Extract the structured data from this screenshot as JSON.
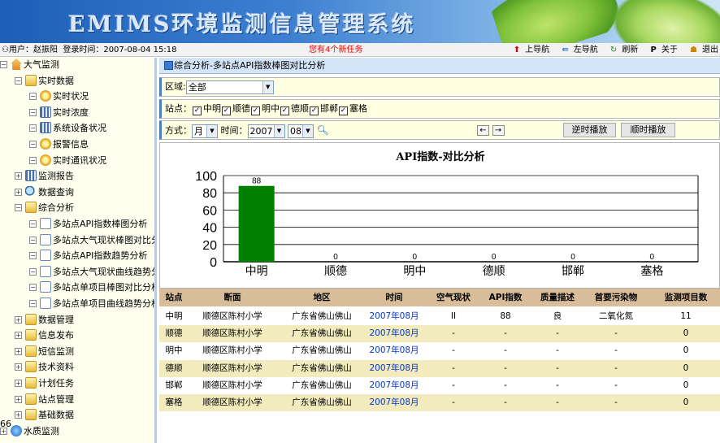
{
  "banner": {
    "title": "EMIMS环境监测信息管理系统"
  },
  "topbar": {
    "user_label": "用户：赵振阳",
    "login_label": "登录时间：2007-08-04 15:18",
    "notice": "您有4个新任务",
    "nav": {
      "up": "上导航",
      "left": "左导航",
      "refresh": "刷新",
      "about": "关于",
      "exit": "退出"
    }
  },
  "sidebar": {
    "items": [
      {
        "label": "大气监测",
        "icon": "home-icon",
        "level": 0,
        "expanded": true
      },
      {
        "label": "实时数据",
        "icon": "folder-icon",
        "level": 1,
        "expanded": true
      },
      {
        "label": "实时状况",
        "icon": "gear-icon",
        "level": 2
      },
      {
        "label": "实时浓度",
        "icon": "grid-icon",
        "level": 2
      },
      {
        "label": "系统设备状况",
        "icon": "grid-icon",
        "level": 2
      },
      {
        "label": "报警信息",
        "icon": "gear-icon",
        "level": 2
      },
      {
        "label": "实时通讯状况",
        "icon": "gear-icon",
        "level": 2
      },
      {
        "label": "监测报告",
        "icon": "grid-icon",
        "level": 1,
        "expanded": false
      },
      {
        "label": "数据查询",
        "icon": "search-icon",
        "level": 1,
        "expanded": false
      },
      {
        "label": "综合分析",
        "icon": "folder-icon",
        "level": 1,
        "expanded": true
      },
      {
        "label": "多站点API指数棒图分析",
        "icon": "doc-icon",
        "level": 2
      },
      {
        "label": "多站点大气现状棒图对比分",
        "icon": "doc-icon",
        "level": 2
      },
      {
        "label": "多站点API指数趋势分析",
        "icon": "doc-icon",
        "level": 2
      },
      {
        "label": "多站点大气现状曲线趋势分",
        "icon": "doc-icon",
        "level": 2
      },
      {
        "label": "多站点单项目棒图对比分析",
        "icon": "doc-icon",
        "level": 2
      },
      {
        "label": "多站点单项目曲线趋势分析",
        "icon": "doc-icon",
        "level": 2
      },
      {
        "label": "数据管理",
        "icon": "folder-icon",
        "level": 1,
        "expanded": false
      },
      {
        "label": "信息发布",
        "icon": "folder-icon",
        "level": 1,
        "expanded": false
      },
      {
        "label": "短信监测",
        "icon": "folder-icon",
        "level": 1,
        "expanded": false
      },
      {
        "label": "技术资料",
        "icon": "folder-icon",
        "level": 1,
        "expanded": false
      },
      {
        "label": "计划任务",
        "icon": "folder-icon",
        "level": 1,
        "expanded": false
      },
      {
        "label": "站点管理",
        "icon": "folder-icon",
        "level": 1,
        "expanded": false
      },
      {
        "label": "基础数据",
        "icon": "folder-icon",
        "level": 1,
        "expanded": false
      },
      {
        "label": "水质监测",
        "icon": "globe-icon",
        "level": 0,
        "expanded": false
      }
    ],
    "page_number": "66"
  },
  "crumb": "综合分析-多站点API指数棒图对比分析",
  "filters": {
    "region_label": "区域:",
    "region_value": "全部",
    "station_label": "站点：",
    "stations": [
      "中明",
      "顺德",
      "明中",
      "德顺",
      "邯郸",
      "塞格"
    ],
    "mode_label": "方式：",
    "mode_value": "月",
    "time_label": "时间：",
    "year_value": "2007",
    "month_value": "08",
    "prev_label": "←",
    "next_label": "→",
    "reverse_play": "逆时播放",
    "forward_play": "顺时播放"
  },
  "chart_data": {
    "type": "bar",
    "title": "API指数-对比分析",
    "categories": [
      "中明",
      "顺德",
      "明中",
      "德顺",
      "邯郸",
      "塞格"
    ],
    "values": [
      88,
      0,
      0,
      0,
      0,
      0
    ],
    "ylim": [
      0,
      100
    ],
    "yticks": [
      0,
      20,
      40,
      60,
      80,
      100
    ],
    "bar_color": "#008000",
    "grid": true
  },
  "table": {
    "headers": [
      "站点",
      "断面",
      "地区",
      "时间",
      "空气现状",
      "API指数",
      "质量描述",
      "首要污染物",
      "监测项目数"
    ],
    "rows": [
      [
        "中明",
        "顺德区陈村小学",
        "广东省佛山佛山",
        "2007年08月",
        "II",
        "88",
        "良",
        "二氧化氮",
        "11"
      ],
      [
        "顺德",
        "顺德区陈村小学",
        "广东省佛山佛山",
        "2007年08月",
        "-",
        "-",
        "-",
        "-",
        "0"
      ],
      [
        "明中",
        "顺德区陈村小学",
        "广东省佛山佛山",
        "2007年08月",
        "-",
        "-",
        "-",
        "-",
        "0"
      ],
      [
        "德顺",
        "顺德区陈村小学",
        "广东省佛山佛山",
        "2007年08月",
        "-",
        "-",
        "-",
        "-",
        "0"
      ],
      [
        "邯郸",
        "顺德区陈村小学",
        "广东省佛山佛山",
        "2007年08月",
        "-",
        "-",
        "-",
        "-",
        "0"
      ],
      [
        "塞格",
        "顺德区陈村小学",
        "广东省佛山佛山",
        "2007年08月",
        "-",
        "-",
        "-",
        "-",
        "0"
      ]
    ]
  }
}
